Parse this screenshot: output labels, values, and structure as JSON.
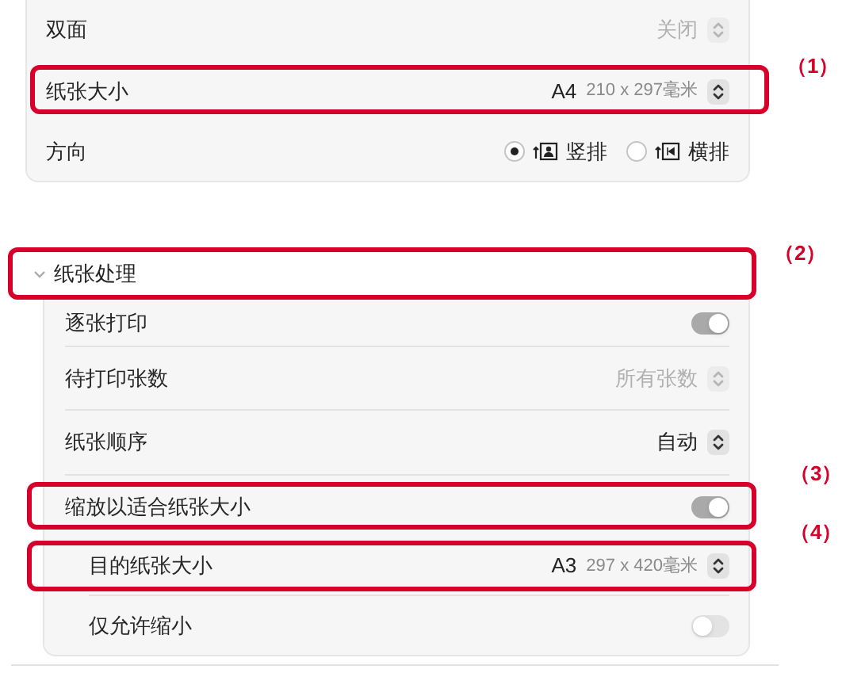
{
  "top_rows": [
    {
      "kind": "popup",
      "label": "双面",
      "value": "关闭",
      "disabled": true
    },
    {
      "kind": "popup",
      "label": "纸张大小",
      "value": "A4",
      "detail": "210 x 297毫米",
      "disabled": false,
      "callout": "（1）"
    },
    {
      "kind": "radio",
      "label": "方向",
      "options": [
        {
          "label": "竖排",
          "kind": "portrait",
          "selected": true
        },
        {
          "label": "横排",
          "kind": "landscape",
          "selected": false
        }
      ]
    }
  ],
  "section": {
    "title": "纸张处理",
    "expanded": true,
    "callout": "（2）",
    "rows": [
      {
        "kind": "toggle",
        "label": "逐张打印",
        "on": true
      },
      {
        "kind": "popup",
        "label": "待打印张数",
        "value": "所有张数",
        "disabled": true
      },
      {
        "kind": "popup",
        "label": "纸张顺序",
        "value": "自动",
        "disabled": false
      },
      {
        "kind": "toggle",
        "label": "缩放以适合纸张大小",
        "on": true,
        "callout": "（3）",
        "children": [
          {
            "kind": "popup",
            "label": "目的纸张大小",
            "value": "A3",
            "detail": "297 x 420毫米",
            "disabled": false,
            "callout": "（4）"
          },
          {
            "kind": "toggle",
            "label": "仅允许缩小",
            "on": false
          }
        ]
      }
    ]
  }
}
